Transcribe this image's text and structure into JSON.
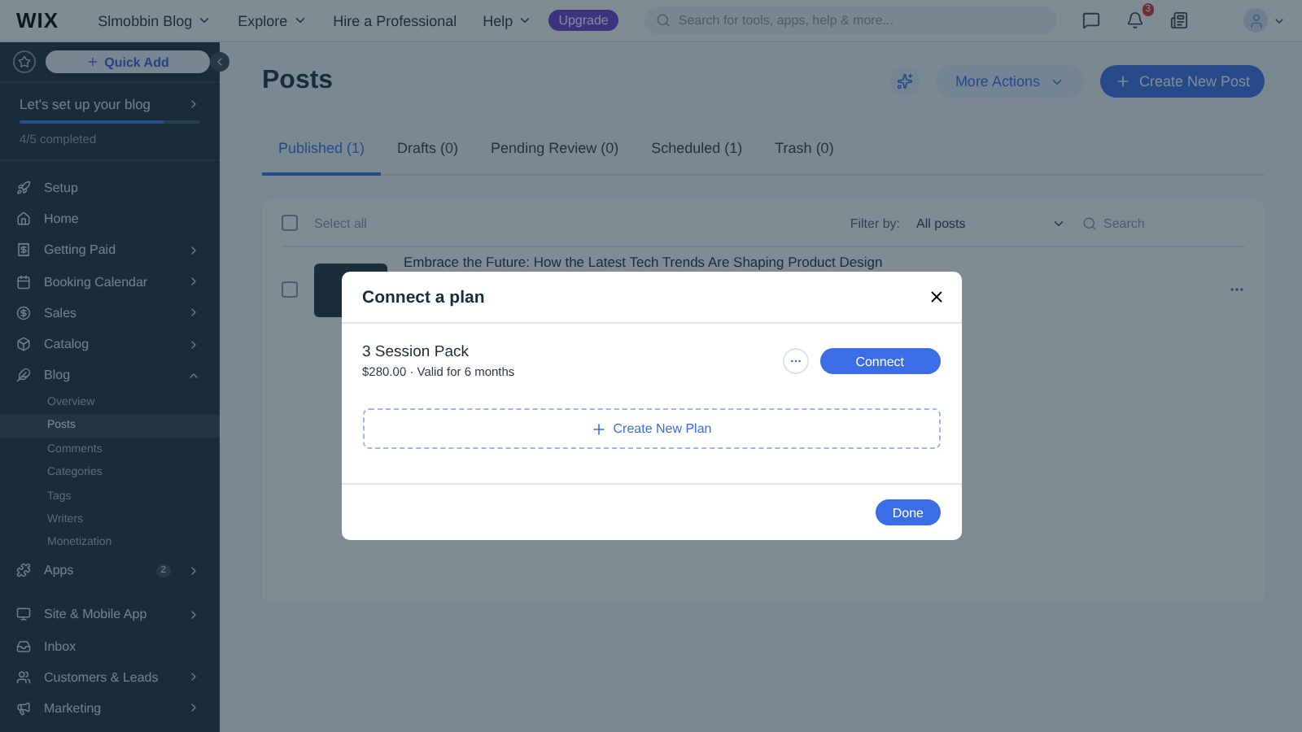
{
  "topbar": {
    "logo": "WIX",
    "site": "Slmobbin Blog",
    "menu": [
      {
        "label": "Explore",
        "dropdown": true
      },
      {
        "label": "Hire a Professional",
        "dropdown": false
      },
      {
        "label": "Help",
        "dropdown": true
      }
    ],
    "upgrade": "Upgrade",
    "search": {
      "placeholder": "Search for tools, apps, help & more..."
    },
    "notifications": "3"
  },
  "sidebar": {
    "quick_add": "Quick Add",
    "setup": {
      "title": "Let's set up your blog",
      "level": 0.8,
      "progress": "4/5 completed"
    },
    "items": [
      {
        "label": "Setup",
        "arrow": false
      },
      {
        "label": "Home",
        "arrow": false
      },
      {
        "label": "Getting Paid",
        "arrow": true
      },
      {
        "label": "Booking Calendar",
        "arrow": true
      },
      {
        "label": "Sales",
        "arrow": true
      },
      {
        "label": "Catalog",
        "arrow": true
      },
      {
        "label": "Blog",
        "arrow": true,
        "expanded": true,
        "children": [
          {
            "label": "Overview",
            "selected": false
          },
          {
            "label": "Posts",
            "selected": true
          },
          {
            "label": "Comments",
            "selected": false
          },
          {
            "label": "Categories",
            "selected": false
          },
          {
            "label": "Tags",
            "selected": false
          },
          {
            "label": "Writers",
            "selected": false
          },
          {
            "label": "Monetization",
            "selected": false
          }
        ]
      },
      {
        "label": "Apps",
        "arrow": true,
        "badge": "2"
      },
      {
        "label": "Site & Mobile App",
        "arrow": true
      },
      {
        "label": "Inbox",
        "arrow": false
      },
      {
        "label": "Customers & Leads",
        "arrow": true
      },
      {
        "label": "Marketing",
        "arrow": true
      }
    ]
  },
  "page": {
    "title": "Posts",
    "more_actions": "More Actions",
    "create": "Create New Post",
    "tabs": [
      {
        "label": "Published (1)",
        "selected": true
      },
      {
        "label": "Drafts (0)",
        "selected": false
      },
      {
        "label": "Pending Review (0)",
        "selected": false
      },
      {
        "label": "Scheduled (1)",
        "selected": false
      },
      {
        "label": "Trash (0)",
        "selected": false
      }
    ],
    "select_all": "Select all",
    "select_all_checked": false,
    "filter_label": "Filter by:",
    "filter_value": "All posts",
    "search": {
      "placeholder": "Search"
    },
    "posts": [
      {
        "title": "Embrace the Future: How the Latest Tech Trends Are Shaping Product Design",
        "checked": false
      }
    ]
  },
  "dialog": {
    "title": "Connect a plan",
    "plans": [
      {
        "name": "3 Session Pack",
        "details": "$280.00 · Valid for 6 months",
        "action": "Connect"
      }
    ],
    "create_plan": "Create New Plan",
    "done": "Done"
  }
}
